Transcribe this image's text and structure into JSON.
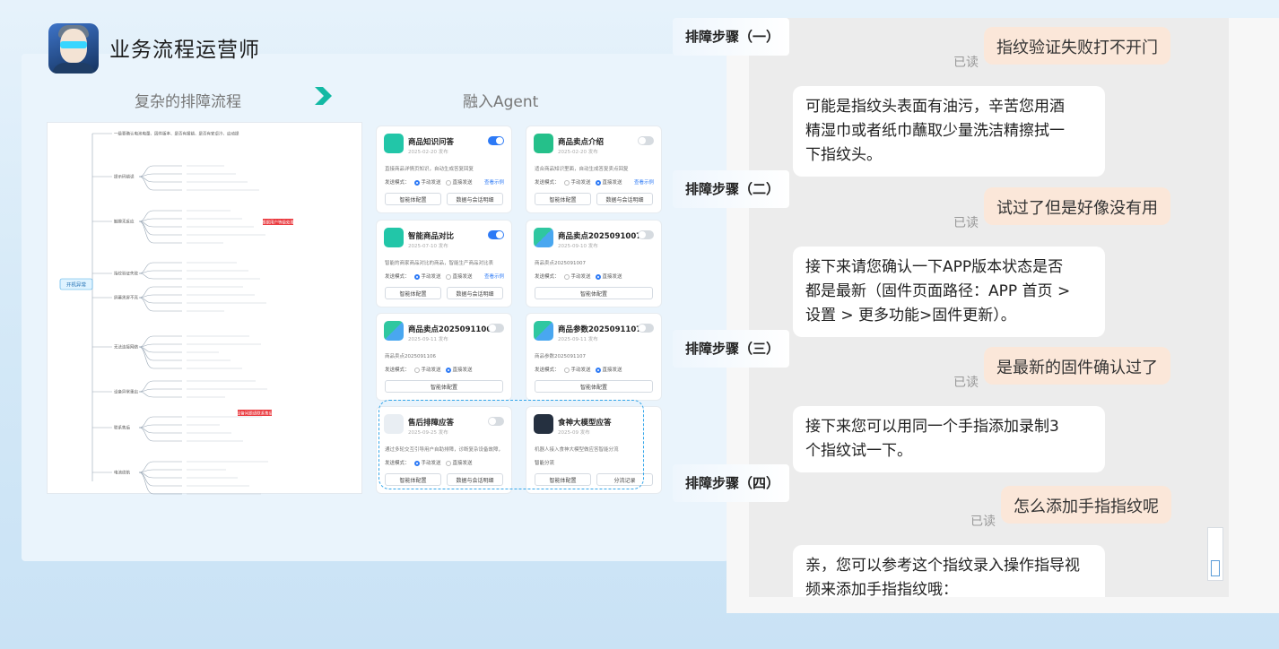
{
  "header": {
    "title": "业务流程运营师"
  },
  "compare": {
    "left_label": "复杂的排障流程",
    "right_label": "融入Agent"
  },
  "mindmap": {
    "root": "开机异常",
    "branches": [
      {
        "label": "一级要确认电池电量、固件版本、是否有报错、是否有安卓冷、启动提"
      },
      {
        "label": "提示码错误"
      },
      {
        "label": "触摸无反应"
      },
      {
        "label": "指纹验证失败"
      },
      {
        "label": "屏幕黑屏不亮"
      },
      {
        "label": "无法连接网络"
      },
      {
        "label": "设备异常重启"
      },
      {
        "label": "联系售后"
      },
      {
        "label": "电池续航"
      }
    ],
    "highlight_1": "根据用户等级处理",
    "highlight_2": "设备问题请联系售后"
  },
  "cards": [
    {
      "title": "商品知识问答",
      "date": "2025-02-20 发布",
      "desc": "直接商品详情页知识，自动生成答复回复",
      "on": true,
      "link": "查看示例",
      "btn1": "智能体配置",
      "btn2": "数据与会话明细",
      "icon": "chat"
    },
    {
      "title": "商品卖点介绍",
      "date": "2025-02-20 发布",
      "desc": "适合商品知识里面，自动生成答复卖点回复",
      "on": false,
      "link": "查看示例",
      "btn1": "智能体配置",
      "btn2": "数据与会话明细",
      "icon": "bag"
    },
    {
      "title": "智能商品对比",
      "date": "2025-07-10 发布",
      "desc": "智能的商家商品对比的商品，智能生产商品对比表",
      "on": true,
      "link": "查看示例",
      "btn1": "智能体配置",
      "btn2": "数据与会话明细",
      "icon": "compare"
    },
    {
      "title": "商品卖点2025091007",
      "date": "2025-09-10 发布",
      "desc": "商品卖点2025091007",
      "on": false,
      "link": "",
      "btn1": "智能体配置",
      "btn2": "",
      "icon": "grid"
    },
    {
      "title": "商品卖点2025091106",
      "date": "2025-09-11 发布",
      "desc": "商品卖点2025091106",
      "on": false,
      "link": "",
      "btn1": "智能体配置",
      "btn2": "",
      "icon": "grid"
    },
    {
      "title": "商品参数2025091107",
      "date": "2025-09-11 发布",
      "desc": "商品参数2025091107",
      "on": false,
      "link": "",
      "btn1": "智能体配置",
      "btn2": "",
      "icon": "grid"
    },
    {
      "title": "售后排障应答",
      "date": "2025-09-25 发布",
      "desc": "通过多轮交互引导用户自助排障，诊断复杂设备故障，提供方案",
      "on": false,
      "link": "",
      "btn1": "智能体配置",
      "btn2": "数据与会话明细",
      "icon": "img"
    },
    {
      "title": "食神大模型应答",
      "date": "2025-09 发布",
      "desc": "机器人接入食神大模型做应答智能分流",
      "on": null,
      "link": "",
      "btn1": "智能体配置",
      "btn2": "分流记录",
      "icon": "dark",
      "extra": "智能分流"
    }
  ],
  "radio": {
    "label": "发送模式：",
    "manual": "手动发送",
    "direct": "直接发送"
  },
  "chat": {
    "read_label": "已读",
    "steps": [
      "排障步骤（一）",
      "排障步骤（二）",
      "排障步骤（三）",
      "排障步骤（四）"
    ],
    "user_msgs": [
      "指纹验证失败打不开门",
      "试过了但是好像没有用",
      "是最新的固件确认过了",
      "怎么添加手指指纹呢"
    ],
    "bot_msgs": [
      [
        "可能是指纹头表面有油污，辛苦您用酒",
        "精湿巾或者纸巾蘸取少量洗洁精擦拭一",
        "下指纹头。"
      ],
      [
        "接下来请您确认一下APP版本状态是否",
        "都是最新（固件页面路径：APP 首页 >",
        "设置 > 更多功能>固件更新）。"
      ],
      [
        "接下来您可以用同一个手指添加录制3",
        "个指纹试一下。"
      ],
      [
        "亲，您可以参考这个指纹录入操作指导视",
        "频来添加手指指纹哦："
      ]
    ]
  },
  "colors": {
    "accent": "#2d7af6",
    "user_bubble": "#fbe7d9",
    "arrow": "#13b9a4",
    "highlight": "#ea3b40"
  }
}
